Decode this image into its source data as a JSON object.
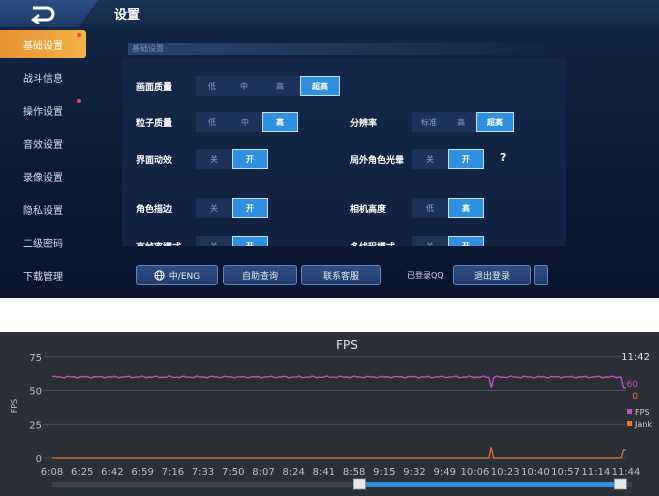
{
  "game": {
    "title": "设置",
    "sidebar": [
      {
        "label": "基础设置",
        "active": true,
        "dot": true
      },
      {
        "label": "战斗信息",
        "active": false,
        "dot": false
      },
      {
        "label": "操作设置",
        "active": false,
        "dot": true
      },
      {
        "label": "音效设置",
        "active": false,
        "dot": false
      },
      {
        "label": "录像设置",
        "active": false,
        "dot": false
      },
      {
        "label": "隐私设置",
        "active": false,
        "dot": false
      },
      {
        "label": "二级密码",
        "active": false,
        "dot": false
      },
      {
        "label": "下载管理",
        "active": false,
        "dot": false
      }
    ],
    "section_label": "基础设置",
    "settings": {
      "graphics": {
        "label": "画面质量",
        "options": [
          "低",
          "中",
          "高",
          "超高"
        ],
        "selected": "超高"
      },
      "particle": {
        "label": "粒子质量",
        "options": [
          "低",
          "中",
          "高"
        ],
        "selected": "高"
      },
      "resolution": {
        "label": "分辨率",
        "options": [
          "标准",
          "高",
          "超高"
        ],
        "selected": "超高"
      },
      "ui_anim": {
        "label": "界面动效",
        "options": [
          "关",
          "开"
        ],
        "selected": "开"
      },
      "outer_halo": {
        "label": "局外角色光晕",
        "options": [
          "关",
          "开"
        ],
        "selected": "开"
      },
      "outline": {
        "label": "角色描边",
        "options": [
          "关",
          "开"
        ],
        "selected": "开"
      },
      "cam_height": {
        "label": "相机高度",
        "options": [
          "低",
          "高"
        ],
        "selected": "高"
      },
      "row5_left": {
        "label": "高帧率模式",
        "options": [
          "关",
          "开"
        ],
        "selected": "开"
      },
      "row5_right": {
        "label": "多线程模式",
        "options": [
          "关",
          "开"
        ],
        "selected": "开"
      }
    },
    "help_mark": "?",
    "buttons": {
      "lang": "中/ENG",
      "self_query": "自助查询",
      "contact": "联系客服",
      "logout": "退出登录"
    },
    "logged_in": "已登录QQ"
  },
  "chart_data": {
    "type": "line",
    "title": "FPS",
    "ylabel": "FPS",
    "y_ticks": [
      0,
      25,
      50,
      75
    ],
    "ylim": [
      0,
      80
    ],
    "x_ticks": [
      "6:08",
      "6:25",
      "6:42",
      "6:59",
      "7:16",
      "7:33",
      "7:50",
      "8:07",
      "8:24",
      "8:41",
      "8:58",
      "9:15",
      "9:32",
      "9:49",
      "10:06",
      "10:23",
      "10:40",
      "10:57",
      "11:14",
      "11:44"
    ],
    "series": [
      {
        "name": "FPS",
        "color": "#c34bc3",
        "baseline": 60,
        "dips": [
          {
            "at": "10:15",
            "value": 52
          },
          {
            "at": "11:44",
            "value": 52
          }
        ]
      },
      {
        "name": "Jank",
        "color": "#e8762b",
        "baseline": 0,
        "spikes": [
          {
            "at": "10:15",
            "value": 8
          },
          {
            "at": "11:44",
            "value": 6
          }
        ]
      }
    ],
    "cursor_time": "11:42",
    "cursor_values": {
      "FPS": "60",
      "Jank": "0"
    },
    "legend": [
      "FPS",
      "Jank"
    ],
    "legend_position": "right",
    "scrollbar_range": [
      0.53,
      0.98
    ]
  }
}
